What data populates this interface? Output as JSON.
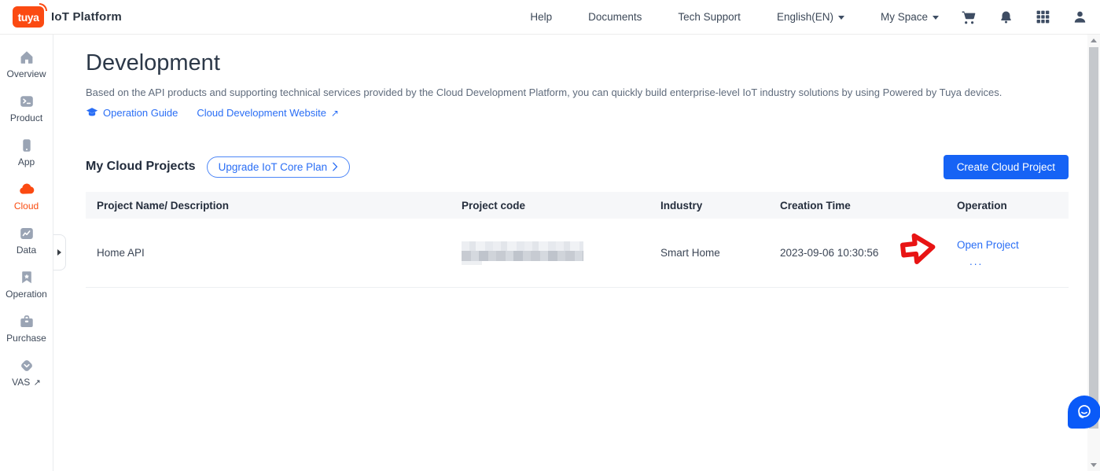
{
  "colors": {
    "brand_orange": "#fb4a12",
    "accent_blue": "#2a6ef5",
    "button_blue": "#1663f5",
    "annotation_red": "#e81414",
    "chat_blue": "#0a5af8"
  },
  "header": {
    "logo_text": "tuya",
    "brand_title": "IoT Platform",
    "nav_items": [
      {
        "label": "Help"
      },
      {
        "label": "Documents"
      },
      {
        "label": "Tech Support"
      },
      {
        "label": "English(EN)"
      },
      {
        "label": "My Space"
      }
    ]
  },
  "sidebar": {
    "items": [
      {
        "label": "Overview"
      },
      {
        "label": "Product"
      },
      {
        "label": "App"
      },
      {
        "label": "Cloud",
        "active": true
      },
      {
        "label": "Data"
      },
      {
        "label": "Operation"
      },
      {
        "label": "Purchase"
      },
      {
        "label": "VAS"
      }
    ]
  },
  "icons": {
    "external_arrow": "↗"
  },
  "main": {
    "page_title": "Development",
    "description": "Based on the API products and supporting technical services provided by the Cloud Development Platform, you can quickly build enterprise-level IoT industry solutions by using Powered by Tuya devices.",
    "guide_link": "Operation Guide",
    "website_link": "Cloud Development Website",
    "section_title": "My Cloud Projects",
    "upgrade_button": "Upgrade IoT Core Plan",
    "create_button": "Create Cloud Project",
    "table": {
      "columns": [
        "Project Name/ Description",
        "Project code",
        "Industry",
        "Creation Time",
        "Operation"
      ],
      "rows": [
        {
          "name": "Home API",
          "code_hidden": true,
          "industry": "Smart Home",
          "creation_time": "2023-09-06 10:30:56",
          "open_link": "Open Project",
          "more": "..."
        }
      ]
    }
  }
}
